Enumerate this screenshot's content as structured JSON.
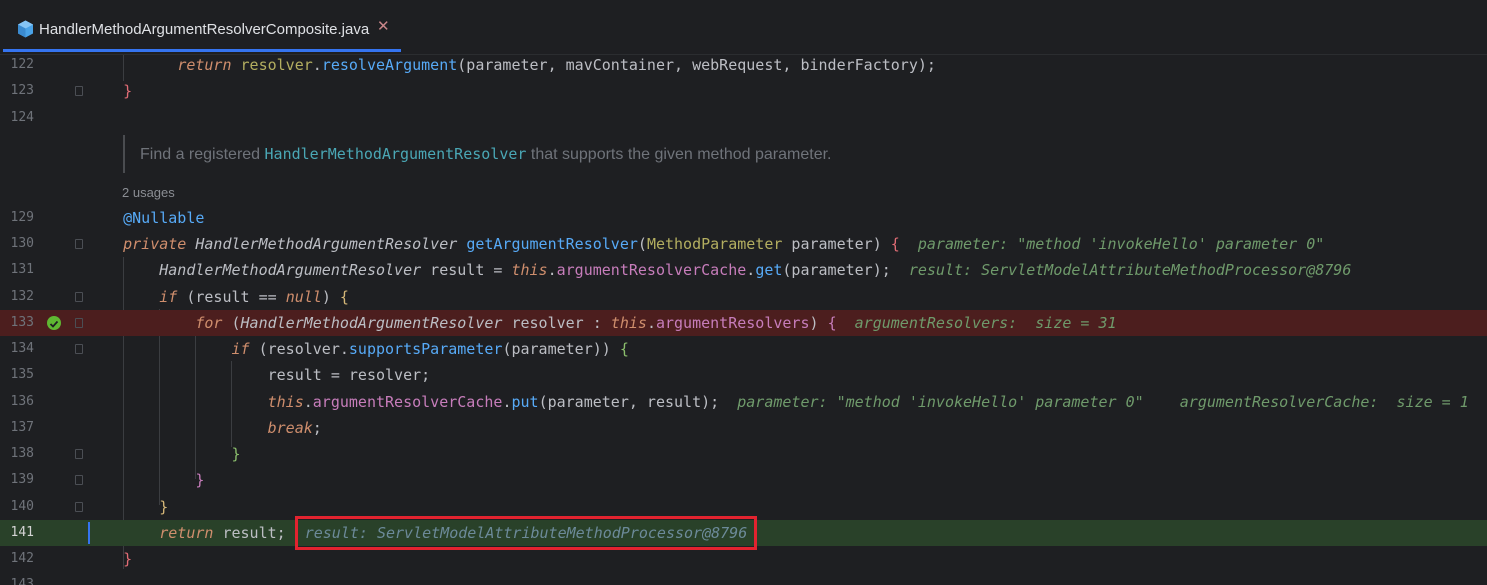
{
  "tab": {
    "icon": "java-class-icon",
    "label": "HandlerMethodArgumentResolverComposite.java",
    "close": "✕"
  },
  "doc": {
    "prefix": "Find a registered ",
    "link": "HandlerMethodArgumentResolver",
    "suffix": " that supports the given method parameter."
  },
  "usages": "2 usages",
  "lines": {
    "n122": "122",
    "n123": "123",
    "n124": "124",
    "n129": "129",
    "n130": "130",
    "n131": "131",
    "n132": "132",
    "n133": "133",
    "n134": "134",
    "n135": "135",
    "n136": "136",
    "n137": "137",
    "n138": "138",
    "n139": "139",
    "n140": "140",
    "n141": "141",
    "n142": "142",
    "n143": "143"
  },
  "code": {
    "l122": {
      "kw": "return",
      "obj": "resolver",
      "dot": ".",
      "method": "resolveArgument",
      "args": "(parameter, mavContainer, webRequest, binderFactory);"
    },
    "l123": {
      "brace": "}"
    },
    "l129": {
      "annotation": "@Nullable"
    },
    "l130": {
      "kw": "private",
      "type": "HandlerMethodArgumentResolver",
      "method": "getArgumentResolver",
      "open": "(",
      "ptype": "MethodParameter",
      "pname": " parameter) ",
      "brace": "{",
      "inlay": "parameter: \"method 'invokeHello' parameter 0\""
    },
    "l131": {
      "type": "HandlerMethodArgumentResolver",
      "rest1": " result = ",
      "kw": "this",
      "dot": ".",
      "field": "argumentResolverCache",
      "dot2": ".",
      "method": "get",
      "rest2": "(parameter);",
      "inlay": "result: ServletModelAttributeMethodProcessor@8796"
    },
    "l132": {
      "kw": "if",
      "rest1": " (result ",
      "op": "==",
      "rest2": " ",
      "kw2": "null",
      "rest3": ") ",
      "brace": "{"
    },
    "l133": {
      "kw": "for",
      "rest1": " (",
      "type": "HandlerMethodArgumentResolver",
      "rest2": " resolver : ",
      "kw2": "this",
      "dot": ".",
      "field": "argumentResolvers",
      "rest3": ") ",
      "brace": "{",
      "inlay": "argumentResolvers:  size = 31"
    },
    "l134": {
      "kw": "if",
      "rest1": " (resolver.",
      "method": "supportsParameter",
      "rest2": "(parameter)) ",
      "brace": "{"
    },
    "l135": {
      "text": "result = resolver;"
    },
    "l136": {
      "kw": "this",
      "dot": ".",
      "field": "argumentResolverCache",
      "dot2": ".",
      "method": "put",
      "rest": "(parameter, result);",
      "inlay1": "parameter: \"method 'invokeHello' parameter 0\"",
      "inlay2": "argumentResolverCache:  size = 1"
    },
    "l137": {
      "kw": "break",
      "rest": ";"
    },
    "l138": {
      "brace": "}"
    },
    "l139": {
      "brace": "}"
    },
    "l140": {
      "brace": "}"
    },
    "l141": {
      "kw": "return",
      "rest": " result;",
      "inlay": "result: ServletModelAttributeMethodProcessor@8796"
    },
    "l142": {
      "brace": "}"
    }
  },
  "colors": {
    "background": "#1e1f22",
    "breakpoint_line": "#4c1e1e",
    "current_line": "#294129",
    "highlight_box": "#e2232f",
    "tab_underline": "#3574f0"
  }
}
